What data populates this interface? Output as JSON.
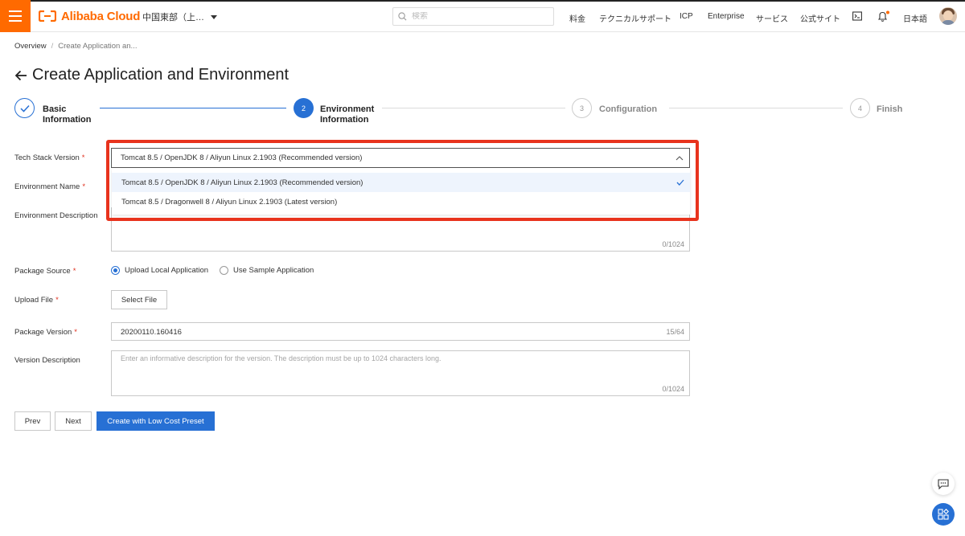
{
  "topbar": {
    "logo_text": "Alibaba Cloud",
    "region": "中国東部（上…",
    "search_placeholder": "検索",
    "nav": [
      "料金",
      "テクニカルサポート",
      "ICP",
      "Enterprise",
      "サービス",
      "公式サイト"
    ],
    "language": "日本語"
  },
  "breadcrumb": {
    "root": "Overview",
    "sep": "/",
    "current": "Create Application an..."
  },
  "page": {
    "title": "Create Application and Environment"
  },
  "steps": [
    {
      "number": "",
      "label_line1": "Basic",
      "label_line2": "Information",
      "state": "done"
    },
    {
      "number": "2",
      "label_line1": "Environment",
      "label_line2": "Information",
      "state": "active"
    },
    {
      "number": "3",
      "label_line1": "Configuration",
      "label_line2": "",
      "state": "pending"
    },
    {
      "number": "4",
      "label_line1": "Finish",
      "label_line2": "",
      "state": "pending"
    }
  ],
  "form": {
    "tech_stack": {
      "label": "Tech Stack Version",
      "value": "Tomcat 8.5 / OpenJDK 8 / Aliyun Linux 2.1903  (Recommended version)",
      "options": [
        "Tomcat 8.5 / OpenJDK 8 / Aliyun Linux 2.1903  (Recommended version)",
        "Tomcat 8.5 / Dragonwell 8 / Aliyun Linux 2.1903  (Latest version)"
      ]
    },
    "env_name": {
      "label": "Environment Name"
    },
    "env_desc": {
      "label": "Environment Description",
      "counter": "0/1024"
    },
    "package_source": {
      "label": "Package Source",
      "options": [
        "Upload Local Application",
        "Use Sample Application"
      ]
    },
    "upload_file": {
      "label": "Upload File",
      "button": "Select File"
    },
    "package_version": {
      "label": "Package Version",
      "value": "20200110.160416",
      "counter": "15/64"
    },
    "version_desc": {
      "label": "Version Description",
      "placeholder": "Enter an informative description for the version. The description must be up to 1024 characters long.",
      "counter": "0/1024"
    }
  },
  "actions": {
    "prev": "Prev",
    "next": "Next",
    "create": "Create with Low Cost Preset"
  },
  "colors": {
    "brand": "#ff6a00",
    "primary": "#2770d4",
    "highlight": "#e8331d"
  }
}
